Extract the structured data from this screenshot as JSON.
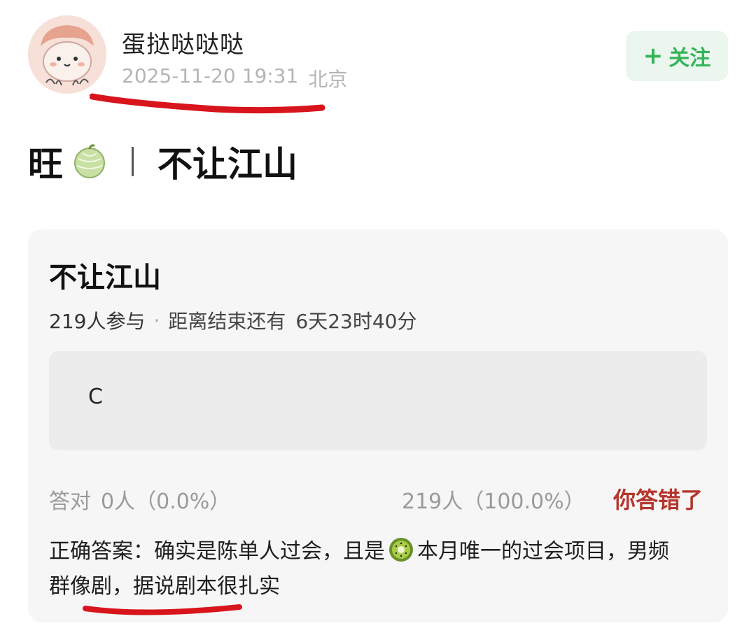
{
  "header": {
    "username": "蛋挞哒哒哒",
    "timestamp": "2025-11-20 19:31",
    "location": "北京",
    "follow_plus": "+",
    "follow_label": "关注"
  },
  "post": {
    "title_prefix": "旺",
    "title_icon": "melon-icon",
    "title_text": "不让江山"
  },
  "quiz": {
    "title": "不让江山",
    "participants": "219人参与",
    "dot": "·",
    "remaining_label": "距离结束还有",
    "remaining_time": "6天23时40分",
    "option_label": "C",
    "correct_label": "答对",
    "correct_count": "0人（0.0%）",
    "wrong_count": "219人（100.0%）",
    "wrong_notice": "你答错了",
    "answer_part1": "正确答案：确实是陈单人过会，且是",
    "answer_icon": "kiwi-icon",
    "answer_part2": "本月唯一的过会项目，男频群像剧，据说剧本很扎实"
  },
  "colors": {
    "follow_green": "#36b45a",
    "follow_bg": "#eaf6ee",
    "wrong_red": "#b5362d",
    "annotation_red": "#d8141c"
  }
}
